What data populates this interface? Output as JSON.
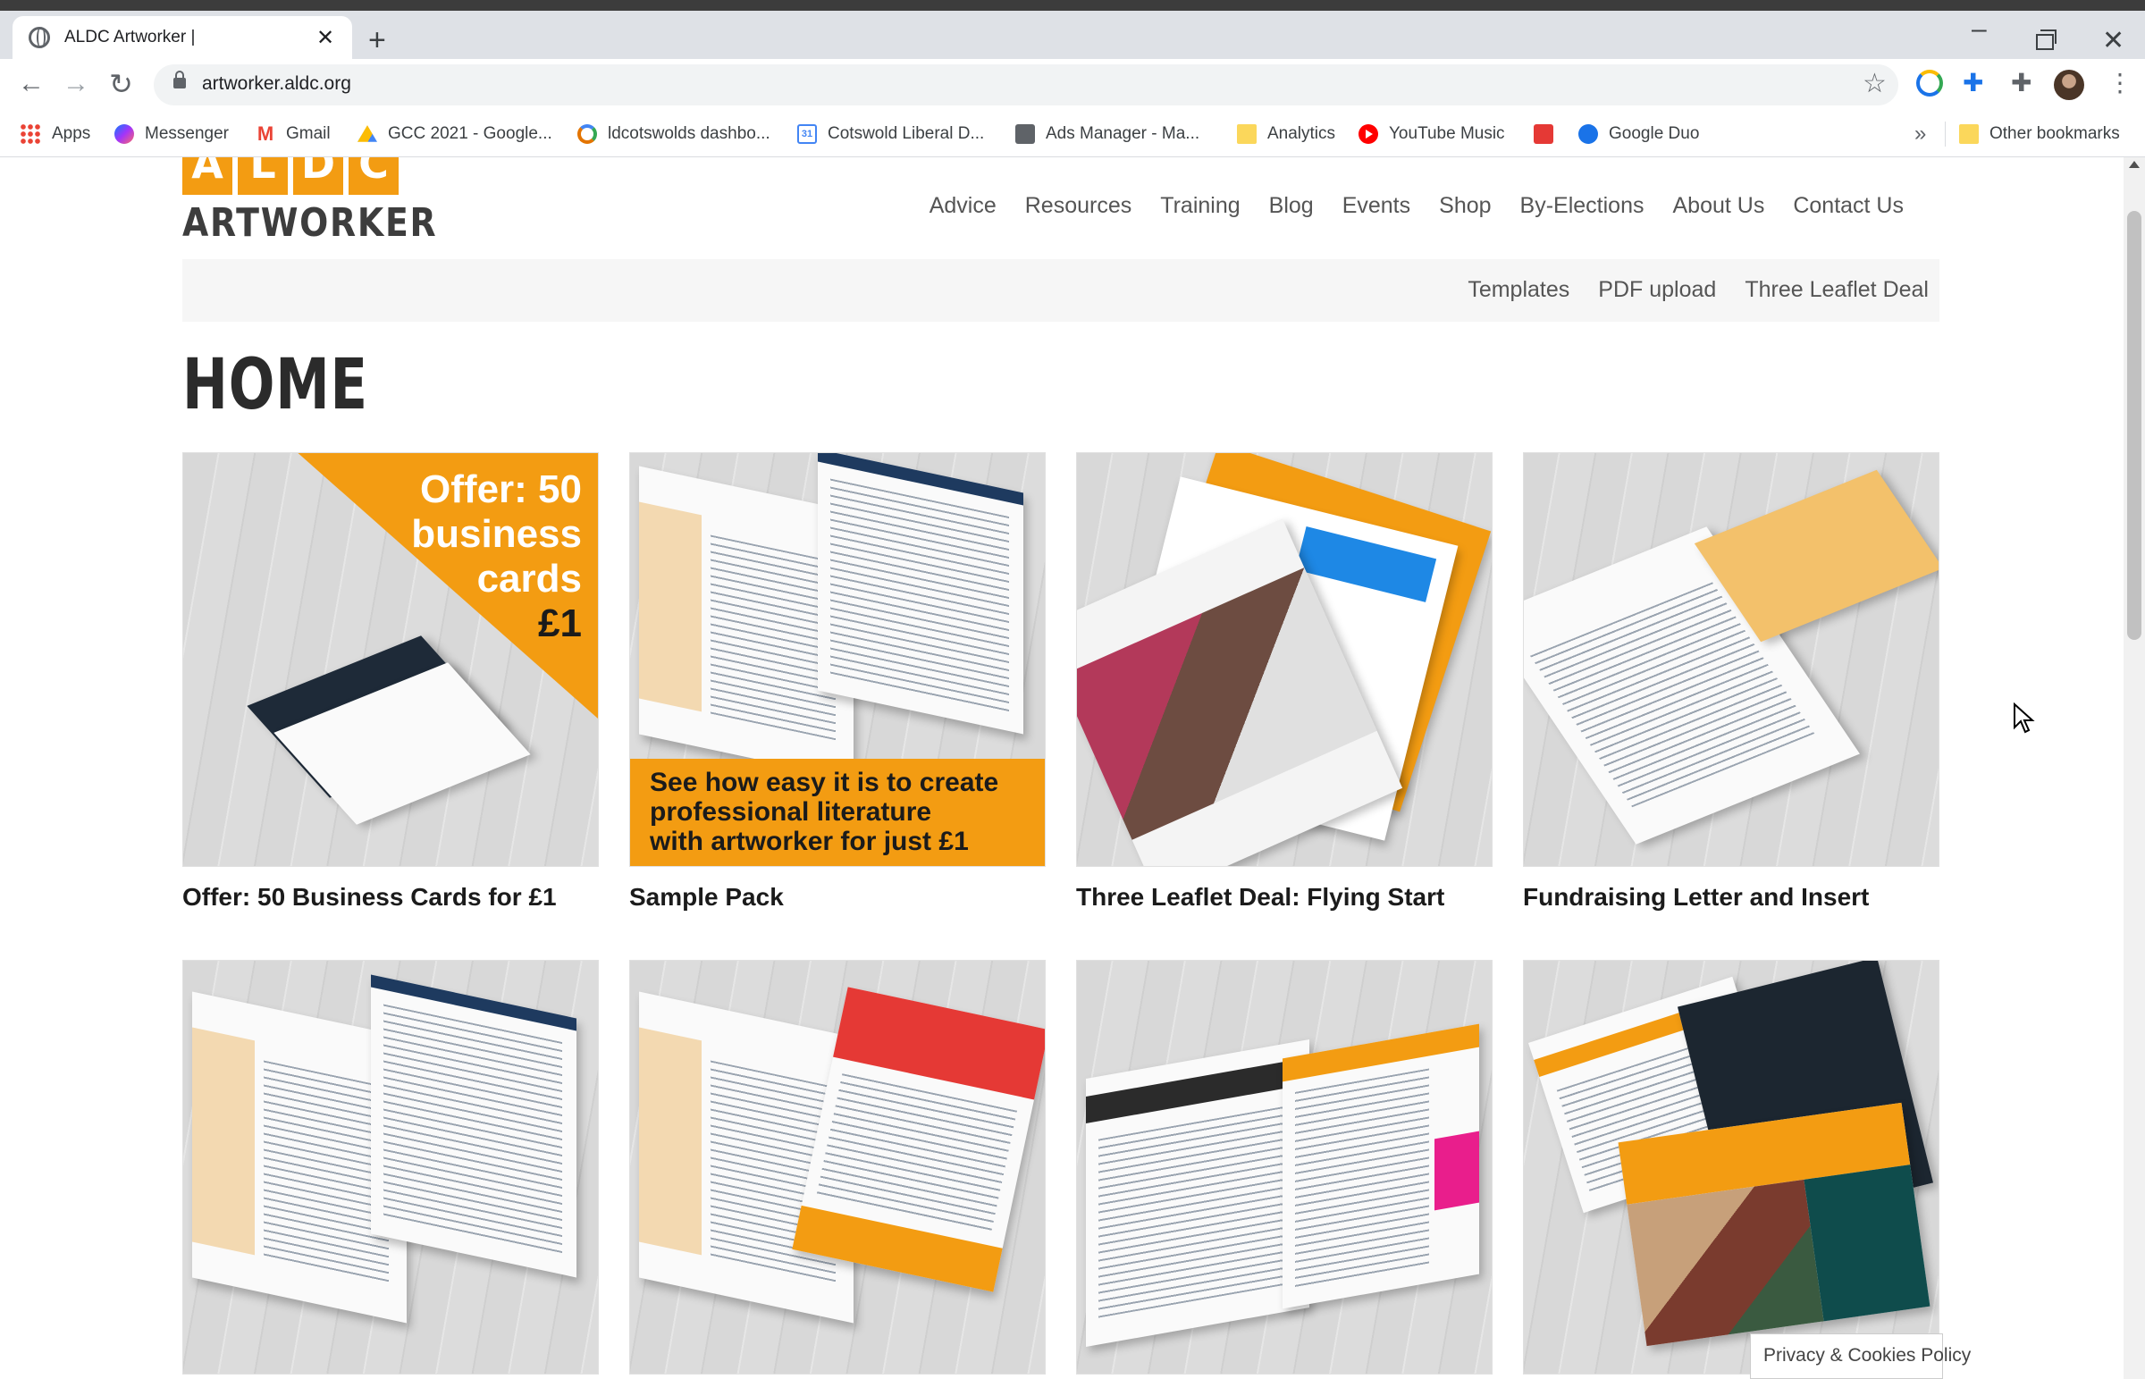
{
  "browser": {
    "tab_title": "ALDC Artworker |",
    "new_tab": "+",
    "url": "artworker.aldc.org"
  },
  "bookmarks": [
    {
      "label": "Apps",
      "icon": "apps-grid-icon"
    },
    {
      "label": "Messenger",
      "icon": "messenger-icon"
    },
    {
      "label": "Gmail",
      "icon": "gmail-icon"
    },
    {
      "label": "GCC 2021 - Google...",
      "icon": "drive-icon"
    },
    {
      "label": "ldcotswolds dashbo...",
      "icon": "ring-icon"
    },
    {
      "label": "Cotswold Liberal D...",
      "icon": "calendar-icon"
    },
    {
      "label": "Ads Manager - Ma...",
      "icon": "ads-icon"
    },
    {
      "label": "Analytics",
      "icon": "folder-icon"
    },
    {
      "label": "YouTube Music",
      "icon": "youtube-music-icon"
    },
    {
      "label": "",
      "icon": "red-bookmark-icon"
    },
    {
      "label": "Google Duo",
      "icon": "duo-icon"
    }
  ],
  "bookmarks_more": "»",
  "other_bookmarks": "Other bookmarks",
  "site": {
    "logo_letters": [
      "A",
      "L",
      "D",
      "C"
    ],
    "logo_text": "ARTWORKER",
    "main_nav": [
      "Advice",
      "Resources",
      "Training",
      "Blog",
      "Events",
      "Shop",
      "By-Elections",
      "About Us",
      "Contact Us"
    ],
    "sub_nav": [
      "Templates",
      "PDF upload",
      "Three Leaflet Deal"
    ],
    "page_title": "HOME"
  },
  "cards": [
    {
      "caption": "Offer: 50 Business Cards for £1",
      "overlay_lines": [
        "Offer: 50",
        "business",
        "cards",
        "£1"
      ]
    },
    {
      "caption": "Sample Pack",
      "overlay_lines": [
        "See how easy it is to create",
        "professional literature",
        "with artworker for just £1"
      ]
    },
    {
      "caption": "Three Leaflet Deal: Flying Start"
    },
    {
      "caption": "Fundraising Letter and Insert"
    },
    {
      "caption": ""
    },
    {
      "caption": ""
    },
    {
      "caption": ""
    },
    {
      "caption": ""
    }
  ],
  "cookie_notice": "Privacy & Cookies Policy",
  "colors": {
    "brand_orange": "#f39c12",
    "nav_text": "#555555",
    "subnav_bg": "#f6f6f6"
  }
}
